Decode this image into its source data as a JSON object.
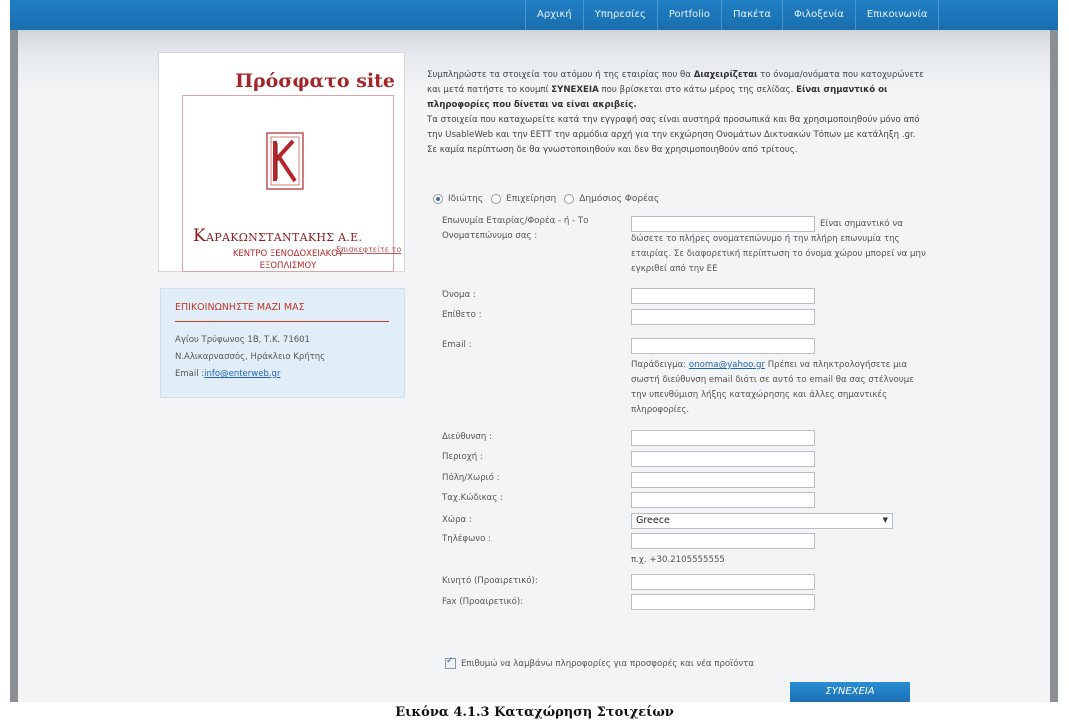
{
  "nav": {
    "items": [
      "Αρχική",
      "Υπηρεσίες",
      "Portfolio",
      "Πακέτα",
      "Φιλοξενία",
      "Επικοινωνία"
    ]
  },
  "promo": {
    "title": "Πρόσφατο site",
    "logo_first": "K",
    "logo_name": "ΑΡΑΚΩΝΣΤΑΝΤΑΚΗΣ Α.Ε.",
    "logo_sub1": "ΚΕΝΤΡΟ ΞΕΝΟΔΟΧΕΙΑΚΟΥ",
    "logo_sub2": "ΕΞΟΠΛΙΣΜΟΥ",
    "link": "Επισκεφτείτε το"
  },
  "contact": {
    "title": "ΕΠΙΚΟΙΝΩΝΗΣΤΕ ΜΑΖΙ ΜΑΣ",
    "address": "Αγίου Τρύφωνος 1Β, Τ.Κ. 71601",
    "city": "Ν.Αλικαρνασσός, Ηράκλειο Κρήτης",
    "email_label": "Email :",
    "email": "info@enterweb.gr"
  },
  "intro": {
    "p1_a": "Συμπληρώστε τα στοιχεία του ατόμου ή της εταιρίας που θα ",
    "p1_b": "Διαχειρίζεται",
    "p1_c": " το όνομα/ονόματα που κατοχυρώνετε και μετά πατήστε το κουμπί ",
    "p1_d": "ΣΥΝΕΧΕΙΑ",
    "p1_e": " που βρίσκεται στο κάτω μέρος της σελίδας. ",
    "p1_f": "Είναι σημαντικό οι πληροφορίες που δίνεται να είναι ακριβείς.",
    "p2": "Τα στοιχεία που καταχωρείτε κατά την εγγραφή σας είναι αυστηρά προσωπικά και θα χρησιμοποιηθούν μόνο από την UsableWeb και την ΕΕΤΤ την αρμόδια αρχή για την εκχώρηση Ονομάτων Δικτυακών Τόπων με κατάληξη .gr.",
    "p3": "Σε καμία περίπτωση δε θα γνωστοποιηθούν και δεν θα χρησιμοποιηθούν από τρίτους."
  },
  "radios": [
    {
      "label": "Ιδιώτης",
      "checked": true
    },
    {
      "label": "Επιχείρηση",
      "checked": false
    },
    {
      "label": "Δημόσιος Φορέας",
      "checked": false
    }
  ],
  "form": {
    "company_label_1": "Επωνυμία Εταιρίας/Φορέα - ή - Το",
    "company_label_2": "Ονοματεπώνυμο σας :",
    "company_note_1": "Είναι σημαντικό να",
    "company_note_rest": "δώσετε το πλήρες ονοματεπώνυμο ή την πλήρη επωνυμία της εταιρίας. Σε διαφορετική περίπτωση το όνομα χώρου μπορεί να μην εγκριθεί από την ΕΕ",
    "name_label": "Όνομα :",
    "surname_label": "Επίθετο :",
    "email_label": "Email :",
    "email_note_a": "Παράδειγμα: ",
    "email_note_link": "onoma@yahoo.gr",
    "email_note_b": " Πρέπει να πληκτρολογήσετε μια σωστή διεύθυνση email διότι σε αυτό το email θα σας στέλνουμε την υπενθύμιση λήξης καταχώρησης και άλλες σημαντικές πληροφορίες.",
    "address_label": "Διεύθυνση :",
    "region_label": "Περιοχή :",
    "city_label": "Πόλη/Χωριό :",
    "zip_label": "Ταχ.Κώδικας :",
    "country_label": "Χώρα :",
    "country_value": "Greece",
    "phone_label": "Τηλέφωνο :",
    "phone_hint": "π.χ. +30.2105555555",
    "mobile_label": "Κινητό (Προαιρετικό):",
    "fax_label": "Fax (Προαιρετικό):",
    "newsletter_label": "Επιθυμώ να λαμβάνω πληροφορίες για προσφορές και νέα προϊόντα",
    "submit_label": "ΣΥΝΕΧΕΙΑ"
  },
  "caption": "Εικόνα 4.1.3 Καταχώρηση Στοιχείων"
}
